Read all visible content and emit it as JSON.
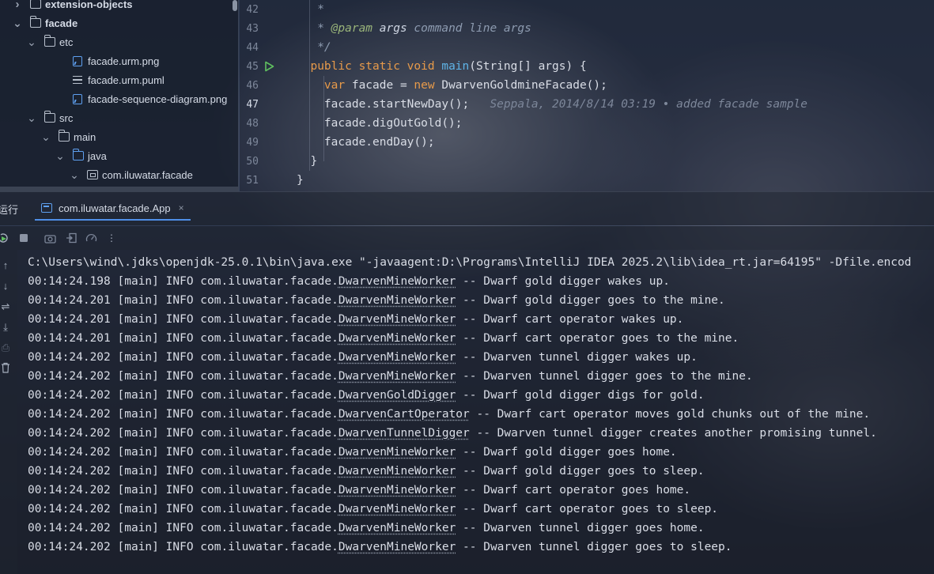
{
  "tree": {
    "items": [
      {
        "label": "extension-objects",
        "bold": true,
        "chevron": ">",
        "icon": "folder-icon"
      },
      {
        "label": "facade",
        "bold": true,
        "chevron": "v",
        "icon": "folder-icon"
      },
      {
        "label": "etc",
        "chevron": "v",
        "icon": "folder-icon"
      },
      {
        "label": "facade.urm.png",
        "icon": "image-file-icon"
      },
      {
        "label": "facade.urm.puml",
        "icon": "text-file-icon"
      },
      {
        "label": "facade-sequence-diagram.png",
        "icon": "image-file-icon"
      },
      {
        "label": "src",
        "chevron": "v",
        "icon": "folder-icon"
      },
      {
        "label": "main",
        "chevron": "v",
        "icon": "folder-icon"
      },
      {
        "label": "java",
        "chevron": "v",
        "icon": "source-folder-icon"
      },
      {
        "label": "com.iluwatar.facade",
        "chevron": "v",
        "icon": "package-icon"
      }
    ]
  },
  "editor": {
    "lines": [
      {
        "num": "42",
        "tokens": [
          {
            "t": "   *",
            "c": "cmt"
          }
        ]
      },
      {
        "num": "43",
        "tokens": [
          {
            "t": "   * ",
            "c": "cmt"
          },
          {
            "t": "@param",
            "c": "tag"
          },
          {
            "t": " args",
            "c": "par"
          },
          {
            "t": " command line args",
            "c": "cmt"
          }
        ]
      },
      {
        "num": "44",
        "tokens": [
          {
            "t": "   */",
            "c": "cmt"
          }
        ]
      },
      {
        "num": "45",
        "tokens": [
          {
            "t": "  ",
            "c": "plain"
          },
          {
            "t": "public static void ",
            "c": "kw"
          },
          {
            "t": "main",
            "c": "fn"
          },
          {
            "t": "(String[] args) {",
            "c": "plain"
          }
        ]
      },
      {
        "num": "46",
        "tokens": [
          {
            "t": "    ",
            "c": "plain"
          },
          {
            "t": "var ",
            "c": "kw"
          },
          {
            "t": "facade = ",
            "c": "plain"
          },
          {
            "t": "new ",
            "c": "kw"
          },
          {
            "t": "DwarvenGoldmineFacade();",
            "c": "plain"
          }
        ]
      },
      {
        "num": "47",
        "tokens": [
          {
            "t": "    facade.startNewDay();",
            "c": "plain"
          },
          {
            "t": "   Seppala, 2014/8/14 03:19 • added facade sample",
            "c": "blame"
          }
        ]
      },
      {
        "num": "48",
        "tokens": [
          {
            "t": "    facade.digOutGold();",
            "c": "plain"
          }
        ]
      },
      {
        "num": "49",
        "tokens": [
          {
            "t": "    facade.endDay();",
            "c": "plain"
          }
        ]
      },
      {
        "num": "50",
        "tokens": [
          {
            "t": "  }",
            "c": "plain"
          }
        ]
      },
      {
        "num": "51",
        "tokens": [
          {
            "t": "}",
            "c": "plain"
          }
        ]
      }
    ],
    "current_line": "47"
  },
  "run": {
    "title": "运行",
    "tab_label": "com.iluwatar.facade.App",
    "tab_close": "×"
  },
  "console": {
    "command_line": "C:\\Users\\wind\\.jdks\\openjdk-25.0.1\\bin\\java.exe \"-javaagent:D:\\Programs\\IntelliJ IDEA 2025.2\\lib\\idea_rt.jar=64195\" -Dfile.encod",
    "log_lines": [
      {
        "time": "00:14:24.198",
        "thread": "[main]",
        "level": "INFO",
        "pkg": "com.iluwatar.facade.",
        "cls": "DwarvenMineWorker",
        "msg": " -- Dwarf gold digger wakes up."
      },
      {
        "time": "00:14:24.201",
        "thread": "[main]",
        "level": "INFO",
        "pkg": "com.iluwatar.facade.",
        "cls": "DwarvenMineWorker",
        "msg": " -- Dwarf gold digger goes to the mine."
      },
      {
        "time": "00:14:24.201",
        "thread": "[main]",
        "level": "INFO",
        "pkg": "com.iluwatar.facade.",
        "cls": "DwarvenMineWorker",
        "msg": " -- Dwarf cart operator wakes up."
      },
      {
        "time": "00:14:24.201",
        "thread": "[main]",
        "level": "INFO",
        "pkg": "com.iluwatar.facade.",
        "cls": "DwarvenMineWorker",
        "msg": " -- Dwarf cart operator goes to the mine."
      },
      {
        "time": "00:14:24.202",
        "thread": "[main]",
        "level": "INFO",
        "pkg": "com.iluwatar.facade.",
        "cls": "DwarvenMineWorker",
        "msg": " -- Dwarven tunnel digger wakes up."
      },
      {
        "time": "00:14:24.202",
        "thread": "[main]",
        "level": "INFO",
        "pkg": "com.iluwatar.facade.",
        "cls": "DwarvenMineWorker",
        "msg": " -- Dwarven tunnel digger goes to the mine."
      },
      {
        "time": "00:14:24.202",
        "thread": "[main]",
        "level": "INFO",
        "pkg": "com.iluwatar.facade.",
        "cls": "DwarvenGoldDigger",
        "msg": " -- Dwarf gold digger digs for gold."
      },
      {
        "time": "00:14:24.202",
        "thread": "[main]",
        "level": "INFO",
        "pkg": "com.iluwatar.facade.",
        "cls": "DwarvenCartOperator",
        "msg": " -- Dwarf cart operator moves gold chunks out of the mine."
      },
      {
        "time": "00:14:24.202",
        "thread": "[main]",
        "level": "INFO",
        "pkg": "com.iluwatar.facade.",
        "cls": "DwarvenTunnelDigger",
        "msg": " -- Dwarven tunnel digger creates another promising tunnel."
      },
      {
        "time": "00:14:24.202",
        "thread": "[main]",
        "level": "INFO",
        "pkg": "com.iluwatar.facade.",
        "cls": "DwarvenMineWorker",
        "msg": " -- Dwarf gold digger goes home."
      },
      {
        "time": "00:14:24.202",
        "thread": "[main]",
        "level": "INFO",
        "pkg": "com.iluwatar.facade.",
        "cls": "DwarvenMineWorker",
        "msg": " -- Dwarf gold digger goes to sleep."
      },
      {
        "time": "00:14:24.202",
        "thread": "[main]",
        "level": "INFO",
        "pkg": "com.iluwatar.facade.",
        "cls": "DwarvenMineWorker",
        "msg": " -- Dwarf cart operator goes home."
      },
      {
        "time": "00:14:24.202",
        "thread": "[main]",
        "level": "INFO",
        "pkg": "com.iluwatar.facade.",
        "cls": "DwarvenMineWorker",
        "msg": " -- Dwarf cart operator goes to sleep."
      },
      {
        "time": "00:14:24.202",
        "thread": "[main]",
        "level": "INFO",
        "pkg": "com.iluwatar.facade.",
        "cls": "DwarvenMineWorker",
        "msg": " -- Dwarven tunnel digger goes home."
      },
      {
        "time": "00:14:24.202",
        "thread": "[main]",
        "level": "INFO",
        "pkg": "com.iluwatar.facade.",
        "cls": "DwarvenMineWorker",
        "msg": " -- Dwarven tunnel digger goes to sleep."
      }
    ]
  },
  "colors": {
    "keyword": "#e79a4a",
    "function": "#5fb4e8",
    "comment": "#8d9bb0",
    "tab_underline": "#4f8fe8",
    "run_icon": "#5fbf5f"
  }
}
